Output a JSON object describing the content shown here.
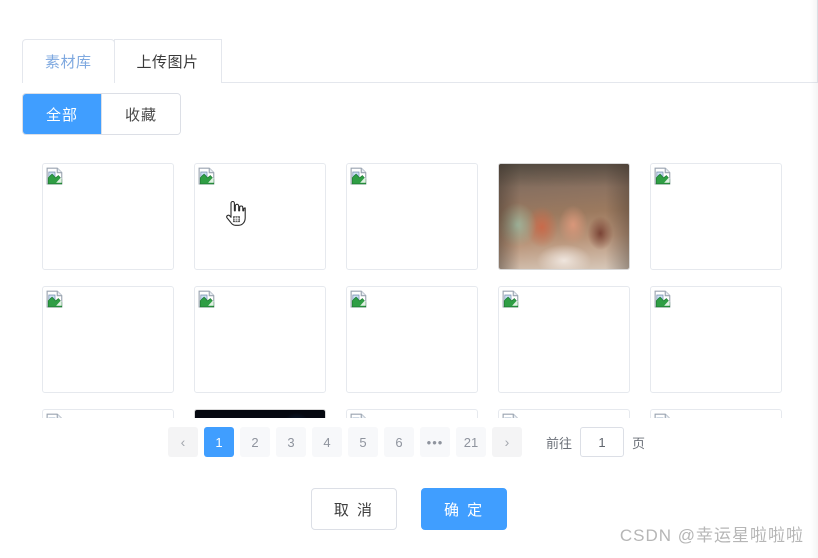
{
  "dialog": {
    "tabs": [
      {
        "label": "素材库",
        "active": true
      },
      {
        "label": "上传图片",
        "active": false
      }
    ],
    "filters": [
      {
        "label": "全部",
        "active": true
      },
      {
        "label": "收藏",
        "active": false
      }
    ]
  },
  "gallery": {
    "columns": 5,
    "rows": [
      [
        {
          "state": "broken",
          "alt": "broken-image"
        },
        {
          "state": "broken",
          "alt": "broken-image"
        },
        {
          "state": "broken",
          "alt": "broken-image"
        },
        {
          "state": "loaded",
          "alt": "kids-playing-illustration"
        },
        {
          "state": "broken",
          "alt": "broken-image"
        }
      ],
      [
        {
          "state": "broken",
          "alt": "broken-image"
        },
        {
          "state": "broken",
          "alt": "broken-image"
        },
        {
          "state": "broken",
          "alt": "broken-image"
        },
        {
          "state": "broken",
          "alt": "broken-image"
        },
        {
          "state": "broken",
          "alt": "broken-image"
        }
      ],
      [
        {
          "state": "broken",
          "alt": "broken-image"
        },
        {
          "state": "loaded-dark",
          "alt": "dark-blue-image"
        },
        {
          "state": "broken",
          "alt": "broken-image"
        },
        {
          "state": "broken",
          "alt": "broken-image"
        },
        {
          "state": "broken",
          "alt": "broken-image"
        }
      ]
    ]
  },
  "pagination": {
    "prev_label": "‹",
    "next_label": "›",
    "pages": [
      "1",
      "2",
      "3",
      "4",
      "5",
      "6"
    ],
    "ellipsis": "•••",
    "last_page": "21",
    "current_page": "1",
    "jump_prefix": "前往",
    "jump_suffix": "页",
    "jump_value": "1"
  },
  "footer": {
    "cancel_label": "取 消",
    "confirm_label": "确 定"
  },
  "watermark": {
    "text": "CSDN @幸运星啦啦啦"
  },
  "colors": {
    "primary": "#409eff",
    "tab_active_text": "#7fa9e0",
    "border": "#dcdfe6",
    "page_bg": "#f4f4f5",
    "watermark": "#b6b6b6"
  }
}
